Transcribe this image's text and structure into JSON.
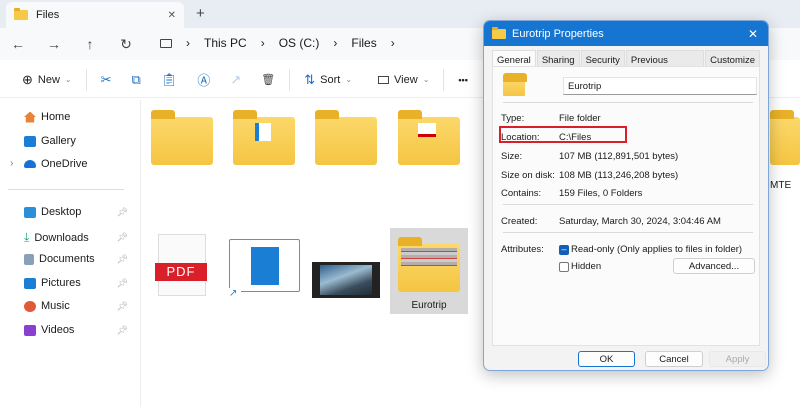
{
  "window": {
    "tab_title": "Files",
    "close": "✕",
    "new_tab": "+"
  },
  "nav": {
    "back": "←",
    "forward": "→",
    "up": "↑",
    "refresh": "↻",
    "breadcrumb": [
      "This PC",
      "OS (C:)",
      "Files"
    ],
    "sep": "›"
  },
  "toolbar": {
    "new": "New",
    "sort": "Sort",
    "view": "View",
    "more": "•••"
  },
  "sidebar": {
    "top": [
      {
        "label": "Home",
        "color": "#e8833a"
      },
      {
        "label": "Gallery",
        "color": "#1a7fd4"
      },
      {
        "label": "OneDrive",
        "color": "#1473d3"
      }
    ],
    "pinned": [
      {
        "label": "Desktop",
        "color": "#2a8fd8"
      },
      {
        "label": "Downloads",
        "color": "#1a9b6a"
      },
      {
        "label": "Documents",
        "color": "#8aa0b8"
      },
      {
        "label": "Pictures",
        "color": "#1a7fd4"
      },
      {
        "label": "Music",
        "color": "#e05a3a"
      },
      {
        "label": "Videos",
        "color": "#8b3fd0"
      }
    ]
  },
  "content": {
    "partial_label": "MTE",
    "selected_label": "Eurotrip",
    "pdf_label": "PDF"
  },
  "dialog": {
    "title": "Eurotrip Properties",
    "close": "✕",
    "tabs": [
      "General",
      "Sharing",
      "Security",
      "Previous Versions",
      "Customize"
    ],
    "name_value": "Eurotrip",
    "props": [
      {
        "k": "Type:",
        "v": "File folder"
      },
      {
        "k": "Location:",
        "v": "C:\\Files"
      },
      {
        "k": "Size:",
        "v": "107 MB (112,891,501 bytes)"
      },
      {
        "k": "Size on disk:",
        "v": "108 MB (113,246,208 bytes)"
      },
      {
        "k": "Contains:",
        "v": "159 Files, 0 Folders"
      }
    ],
    "created_label": "Created:",
    "created_value": "Saturday, March 30, 2024, 3:04:46 AM",
    "attributes_label": "Attributes:",
    "readonly": "Read-only (Only applies to files in folder)",
    "hidden": "Hidden",
    "advanced": "Advanced...",
    "ok": "OK",
    "cancel": "Cancel",
    "apply": "Apply"
  },
  "colors": {
    "accent": "#1675d1",
    "highlight": "#d9202a",
    "folder": "#f5c542"
  }
}
